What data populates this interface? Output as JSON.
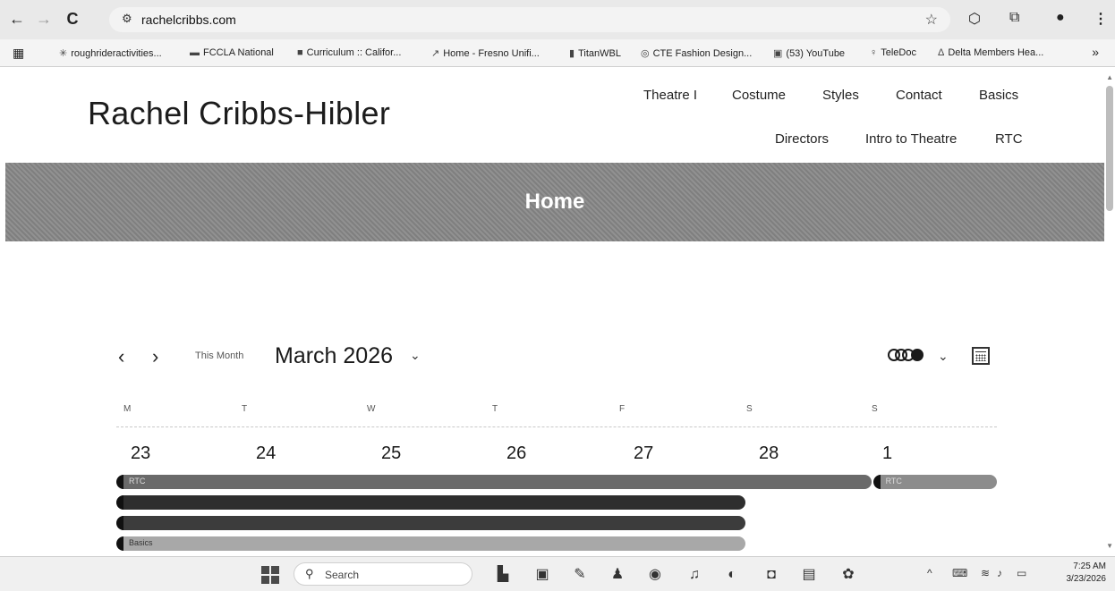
{
  "browser": {
    "url": "rachelcribbs.com",
    "bookmarks": [
      {
        "label": "roughrideractivities...",
        "icon": "✳"
      },
      {
        "label": "FCCLA National",
        "icon": "▬"
      },
      {
        "label": "Curriculum :: Califor...",
        "icon": "■"
      },
      {
        "label": "Home - Fresno Unifi...",
        "icon": "↗"
      },
      {
        "label": "TitanWBL",
        "icon": "▮"
      },
      {
        "label": "CTE Fashion Design...",
        "icon": "◎"
      },
      {
        "label": "(53) YouTube",
        "icon": "▣"
      },
      {
        "label": "TeleDoc",
        "icon": "♀"
      },
      {
        "label": "Delta Members Hea...",
        "icon": "Δ"
      }
    ],
    "more_label": "»"
  },
  "site": {
    "title": "Rachel Cribbs-Hibler",
    "menu_row1": [
      "Theatre I",
      "Costume",
      "Styles",
      "Contact",
      "Basics"
    ],
    "menu_row2": [
      "Directors",
      "Intro to Theatre",
      "RTC"
    ],
    "page_title": "Home"
  },
  "calendar": {
    "this_month_label": "This Month",
    "month_label": "March 2026",
    "weekdays": [
      "M",
      "T",
      "W",
      "T",
      "F",
      "S",
      "S"
    ],
    "days": [
      "23",
      "24",
      "25",
      "26",
      "27",
      "28",
      "1"
    ],
    "events": [
      {
        "label": "RTC",
        "color": "#6a6a6a",
        "row": 0,
        "start": 0,
        "end": 6
      },
      {
        "label": "RTC",
        "color": "#8c8c8c",
        "row": 0,
        "start": 6,
        "end": 7
      },
      {
        "label": "",
        "color": "#2e2e2e",
        "row": 1,
        "start": 0,
        "end": 5
      },
      {
        "label": "",
        "color": "#3c3c3c",
        "row": 2,
        "start": 0,
        "end": 5
      },
      {
        "label": "Basics",
        "color": "#a8a8a8",
        "row": 3,
        "start": 0,
        "end": 5
      }
    ]
  },
  "taskbar": {
    "search_placeholder": "Search",
    "time": "7:25 AM",
    "date": "3/23/2026"
  },
  "colors": {
    "hero": "#8a8a8a",
    "chrome": "#e9e9e9"
  }
}
